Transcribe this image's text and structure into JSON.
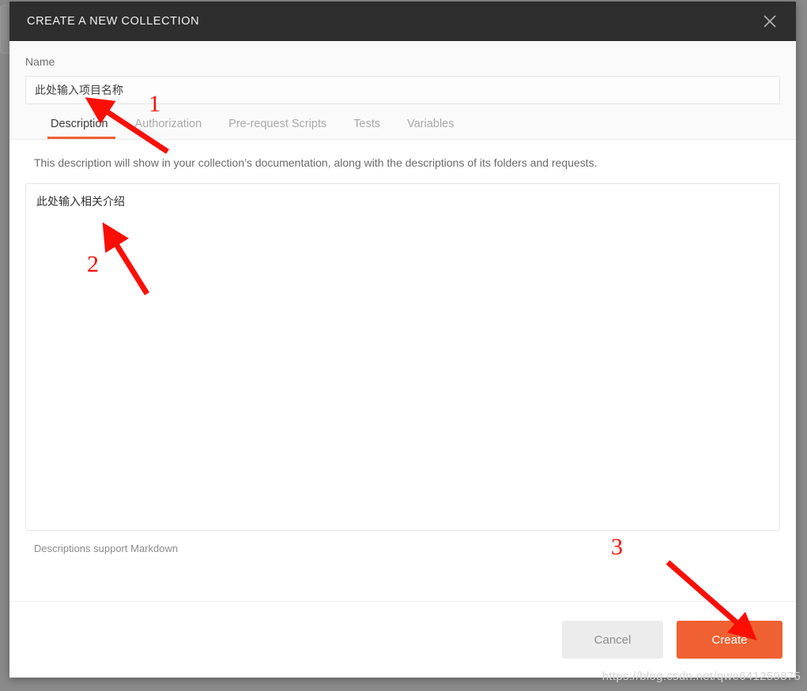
{
  "modal": {
    "title": "CREATE A NEW COLLECTION",
    "close_icon": "close-icon"
  },
  "name_section": {
    "label": "Name",
    "value": "此处输入项目名称",
    "placeholder": "Name"
  },
  "tabs": [
    {
      "label": "Description",
      "active": true
    },
    {
      "label": "Authorization",
      "active": false
    },
    {
      "label": "Pre-request Scripts",
      "active": false
    },
    {
      "label": "Tests",
      "active": false
    },
    {
      "label": "Variables",
      "active": false
    }
  ],
  "description": {
    "helper": "This description will show in your collection’s documentation, along with the descriptions of its folders and requests.",
    "value": "此处输入相关介绍",
    "placeholder": "",
    "markdown_note": "Descriptions support Markdown"
  },
  "footer": {
    "cancel_label": "Cancel",
    "create_label": "Create"
  },
  "annotations": [
    {
      "number": "1"
    },
    {
      "number": "2"
    },
    {
      "number": "3"
    }
  ],
  "watermark": "https://blog.csdn.net/qwe641259875",
  "colors": {
    "accent": "#ef6132",
    "header_bg": "#2e2e2e",
    "annotation": "#fb0f05",
    "backdrop": "#8a8a8a"
  }
}
